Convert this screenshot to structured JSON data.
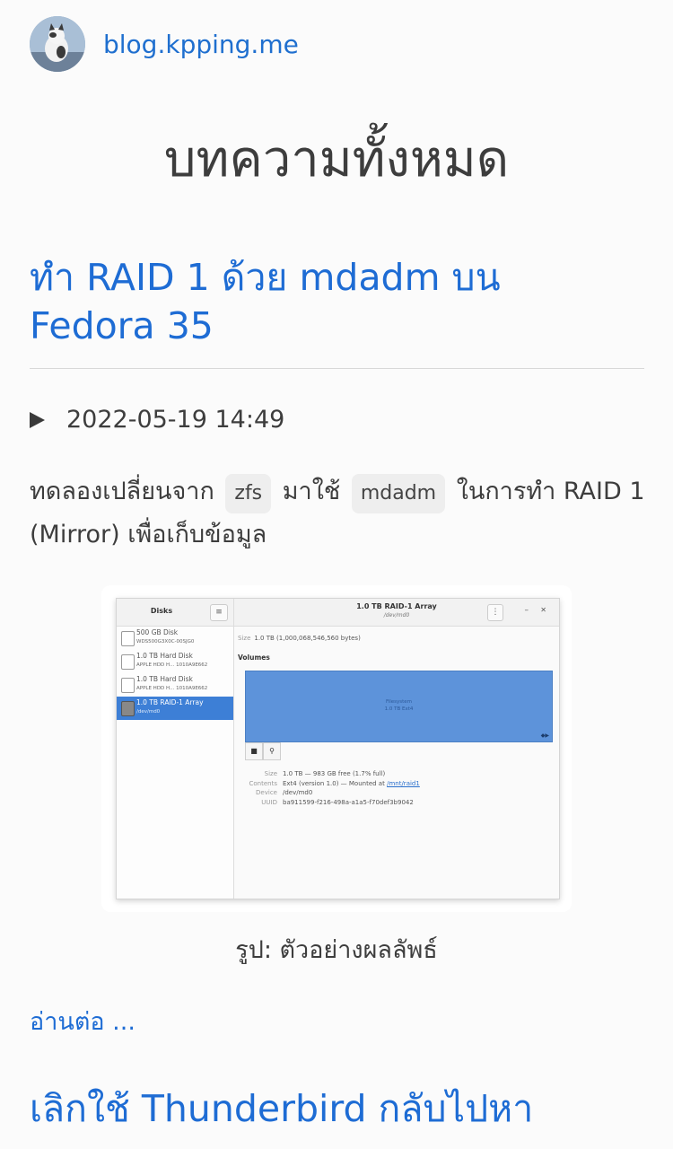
{
  "site": {
    "name": "blog.kpping.me"
  },
  "page_title": "บทความทั้งหมด",
  "post": {
    "title": "ทำ RAID 1 ด้วย mdadm บน Fedora 35",
    "date": "2022-05-19 14:49",
    "excerpt_before": "ทดลองเปลี่ยนจาก",
    "code1": "zfs",
    "excerpt_middle": "มาใช้",
    "code2": "mdadm",
    "excerpt_after": "ในการทำ RAID 1 (Mirror) เพื่อเก็บข้อมูล",
    "caption": "รูป: ตัวอย่างผลลัพธ์",
    "read_more": "อ่านต่อ ..."
  },
  "screenshot": {
    "sidebar_title": "Disks",
    "disks": [
      {
        "name": "500 GB Disk",
        "sub": "WDS500G3X0C-00SJG0",
        "selected": false
      },
      {
        "name": "1.0 TB Hard Disk",
        "sub": "APPLE HDD H... 1010A9E662",
        "selected": false
      },
      {
        "name": "1.0 TB Hard Disk",
        "sub": "APPLE HDD H... 1010A9E662",
        "selected": false
      },
      {
        "name": "1.0 TB RAID-1 Array",
        "sub": "/dev/md0",
        "selected": true
      }
    ],
    "window_title": "1.0 TB RAID-1 Array",
    "window_subtitle": "/dev/md0",
    "size_label": "Size",
    "size_value": "1.0 TB (1,000,068,546,560 bytes)",
    "volumes_label": "Volumes",
    "volume_name": "Filesystem",
    "volume_size": "1.0 TB Ext4",
    "details": {
      "size_k": "Size",
      "size_v": "1.0 TB — 983 GB free (1.7% full)",
      "contents_k": "Contents",
      "contents_v": "Ext4 (version 1.0) — Mounted at",
      "contents_link": "/mnt/raid1",
      "device_k": "Device",
      "device_v": "/dev/md0",
      "uuid_k": "UUID",
      "uuid_v": "ba911599-f216-498a-a1a5-f70def3b9042"
    }
  },
  "next_post": {
    "title": "เลิกใช้ Thunderbird กลับไปหา"
  }
}
